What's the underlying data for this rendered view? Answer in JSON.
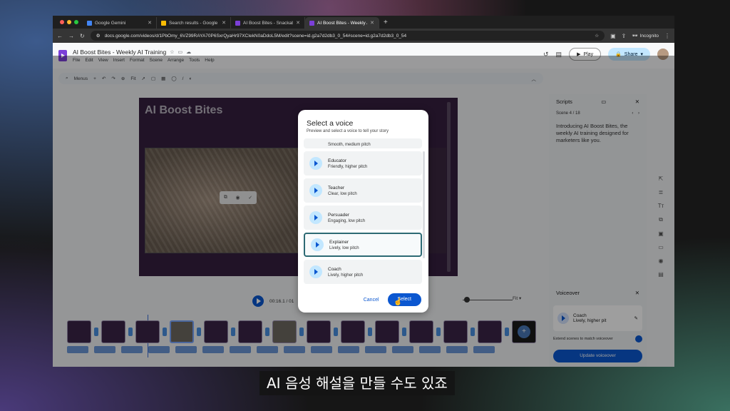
{
  "browser": {
    "tabs": [
      {
        "title": "Google Gemini",
        "color": "#4285f4"
      },
      {
        "title": "Search results - Google Drive",
        "color": "#fbbc04"
      },
      {
        "title": "AI Boost Bites - Snackable T",
        "color": "#7b3fd8"
      },
      {
        "title": "AI Boost Bites - Weekly AI Tra",
        "color": "#7b3fd8",
        "active": true
      }
    ],
    "url": "docs.google.com/videos/d/1PbOmy_6VZ99RAYA70P6SxrQyaHr97XCIekN0aDdoL5M/edit?scene=id.g2a7d2db3_0_54#scene=id.g2a7d2db3_0_54",
    "incognito_label": "Incognito"
  },
  "docs": {
    "title": "AI Boost Bites - Weekly AI Training",
    "menus": [
      "File",
      "Edit",
      "View",
      "Insert",
      "Format",
      "Scene",
      "Arrange",
      "Tools",
      "Help"
    ],
    "play_label": "Play",
    "share_label": "Share",
    "toolbar_menus": "Menus",
    "toolbar_fit": "Fit"
  },
  "canvas": {
    "slide_title": "AI Boost Bites"
  },
  "playback": {
    "time": "00:16.1 / 01",
    "fit_label": "Fit"
  },
  "scripts_panel": {
    "title": "Scripts",
    "scene_counter": "Scene 4 / 18",
    "script_text": "Introducing AI Boost Bites, the weekly AI training designed for marketers like you."
  },
  "voiceover_panel": {
    "title": "Voiceover",
    "voice_name": "Coach",
    "voice_desc": "Lively, higher pit",
    "extend_label": "Extend scenes to match voiceover",
    "update_label": "Update voiceover"
  },
  "modal": {
    "title": "Select a voice",
    "subtitle": "Preview and select a voice to tell your story",
    "partial_desc": "Smooth, medium pitch",
    "voices": [
      {
        "name": "Educator",
        "desc": "Friendly, higher pitch"
      },
      {
        "name": "Teacher",
        "desc": "Clear, low pitch"
      },
      {
        "name": "Persuader",
        "desc": "Engaging, low pitch"
      },
      {
        "name": "Explainer",
        "desc": "Lively, low pitch",
        "selected": true
      },
      {
        "name": "Coach",
        "desc": "Lively, higher pitch"
      }
    ],
    "cancel_label": "Cancel",
    "select_label": "Select"
  },
  "caption": "AI 음성 해설을 만들 수도 있죠"
}
